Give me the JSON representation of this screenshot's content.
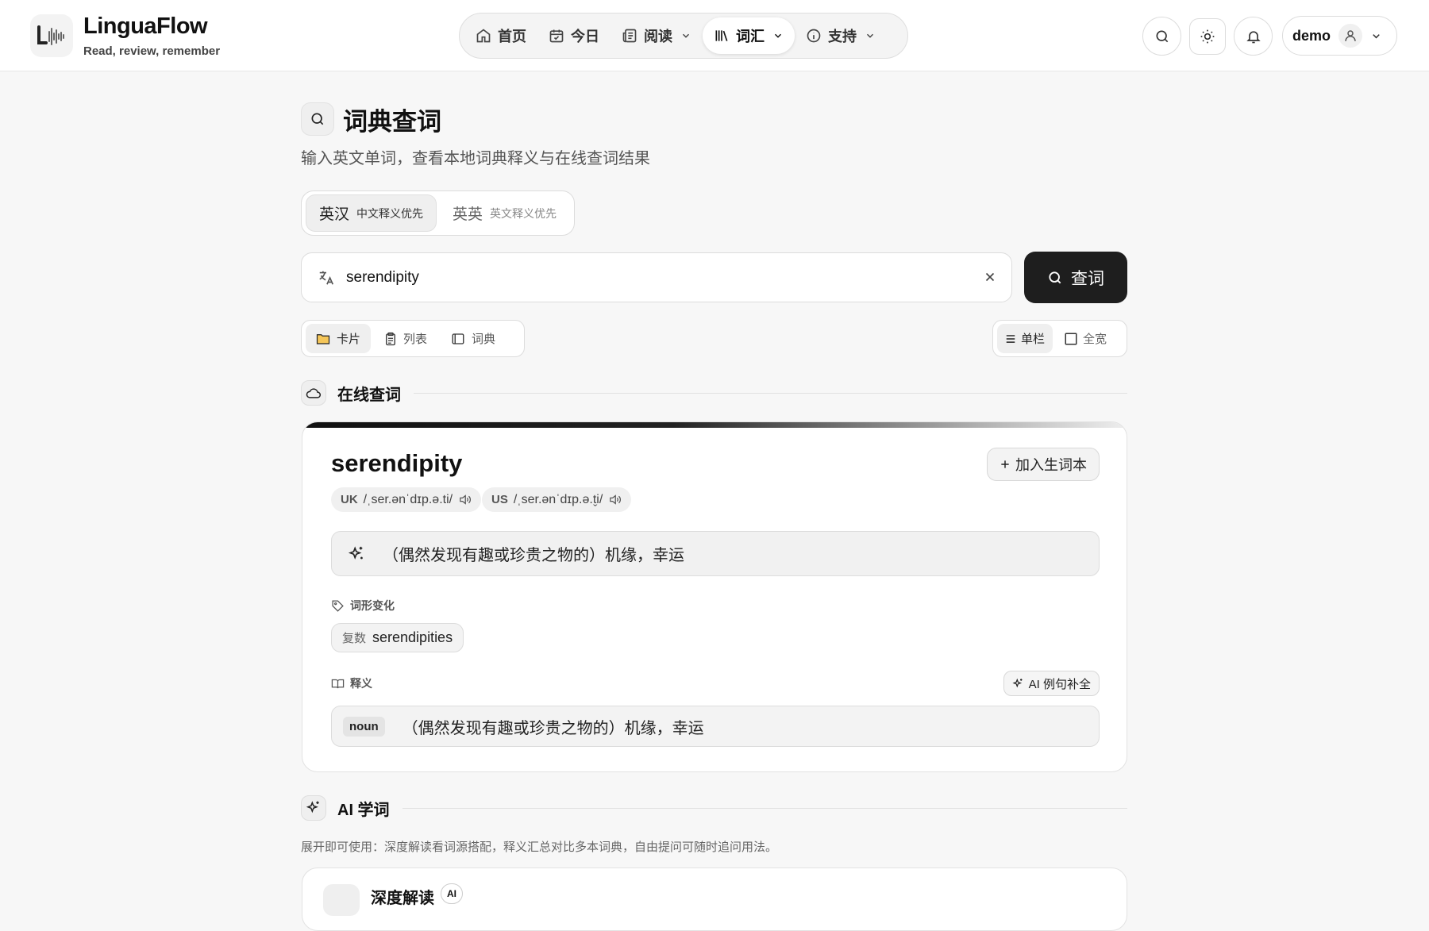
{
  "app": {
    "name": "LinguaFlow",
    "tagline": "Read, review, remember"
  },
  "nav": {
    "items": [
      {
        "label": "首页",
        "icon": "home-icon"
      },
      {
        "label": "今日",
        "icon": "calendar-check-icon"
      },
      {
        "label": "阅读",
        "icon": "newspaper-icon",
        "dropdown": true
      },
      {
        "label": "词汇",
        "icon": "library-icon",
        "dropdown": true,
        "active": true
      },
      {
        "label": "支持",
        "icon": "info-icon",
        "dropdown": true
      }
    ]
  },
  "header_actions": {
    "user": "demo"
  },
  "page": {
    "title": "词典查词",
    "subtitle": "输入英文单词，查看本地词典释义与在线查词结果"
  },
  "mode_toggle": [
    {
      "label": "英汉",
      "sub": "中文释义优先",
      "active": true
    },
    {
      "label": "英英",
      "sub": "英文释义优先",
      "active": false
    }
  ],
  "search": {
    "value": "serendipity",
    "button_label": "查词"
  },
  "view_modes": [
    {
      "label": "卡片",
      "icon": "folder-icon",
      "active": true
    },
    {
      "label": "列表",
      "icon": "clipboard-icon",
      "active": false
    },
    {
      "label": "词典",
      "icon": "book-icon",
      "active": false
    }
  ],
  "layout_modes": [
    {
      "label": "单栏",
      "icon": "list-icon",
      "active": true
    },
    {
      "label": "全宽",
      "icon": "square-icon",
      "active": false
    }
  ],
  "online_section": {
    "title": "在线查词"
  },
  "entry": {
    "word": "serendipity",
    "add_label": "加入生词本",
    "pronunciations": [
      {
        "region": "UK",
        "ipa": "/ˌser.ənˈdɪp.ə.ti/"
      },
      {
        "region": "US",
        "ipa": "/ˌser.ənˈdɪp.ə.t̬i/"
      }
    ],
    "summary": "（偶然发现有趣或珍贵之物的）机缘，幸运",
    "forms_label": "词形变化",
    "forms": [
      {
        "type": "复数",
        "value": "serendipities"
      }
    ],
    "definitions_label": "释义",
    "ai_examples_label": "AI 例句补全",
    "definitions": [
      {
        "pos": "noun",
        "text": "（偶然发现有趣或珍贵之物的）机缘，幸运"
      }
    ]
  },
  "ai_section": {
    "title": "AI 学词",
    "description": "展开即可使用：深度解读看词源搭配，释义汇总对比多本词典，自由提问可随时追问用法。",
    "deep_title": "深度解读",
    "deep_badge": "AI"
  },
  "colors": {
    "primary_button": "#1e1e1e",
    "background": "#f7f7f7",
    "card": "#ffffff"
  }
}
